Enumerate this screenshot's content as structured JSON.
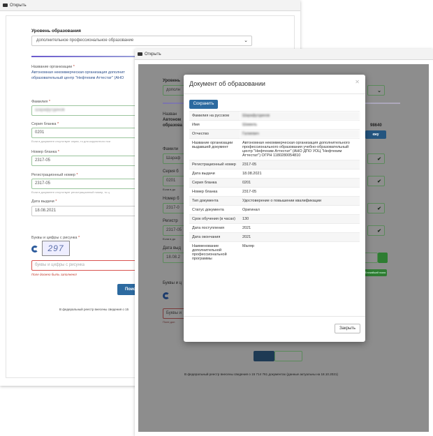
{
  "window_back": {
    "title": "Открыть",
    "education_level_label": "Уровень образования",
    "education_level_value": "дополнительное профессиональное образование",
    "org_label": "Название организации",
    "org_value_line1": "Автономная некоммерческая организация дополнит",
    "org_value_line2": "образовательный центр \"Нефтехим Аттестат\" (АНО",
    "surname_label": "Фамилия",
    "surname_value": "Шарафутдинов",
    "series_label": "Серия бланка",
    "series_value": "0201",
    "series_hint": "Если в документе отсутствует серия, то для корректного пои",
    "number_label": "Номер бланка",
    "number_value": "2317-05",
    "reg_label": "Регистрационный номер",
    "reg_value": "2317-05",
    "reg_hint": "Если в документе отсутствует регистрационный номер, то ц",
    "date_label": "Дата выдачи",
    "date_value": "18.08.2021",
    "captcha_label": "Буквы и цифры с рисунка",
    "captcha_text": "297",
    "captcha_placeholder": "буквы и цифры с рисунка",
    "captcha_error": "Поле должно быть заполнено!",
    "search_button": "Поиск",
    "footer": "В федеральный реестр внесены сведения о 15"
  },
  "window_front": {
    "title": "Открыть",
    "bg_labels": [
      "Уровень",
      "дополн",
      "Назван",
      "Автоном",
      "образова",
      "Фамили",
      "Шараф",
      "Серия б",
      "0201",
      "Если в до",
      "Номер б",
      "2317-0",
      "Регистр",
      "2317-05",
      "Если в до",
      "Дата выд",
      "18.08.2",
      "Буквы и ц",
      "Буквы и",
      "Поле доп"
    ],
    "bg_right_value": "98640",
    "bg_right_btn": "ежу",
    "bg_green_small": "Ближайший поиск",
    "footer": "В федеральный реестр внесены сведения о 15 714 761 документах (данные актуальны на 18.10.2021)"
  },
  "modal": {
    "title": "Документ об образовании",
    "save_button": "Сохранить",
    "close_button": "Закрыть",
    "rows": [
      {
        "k": "Фамилия на русском",
        "v": "Шарафутдинов",
        "blur": true
      },
      {
        "k": "Имя",
        "v": "Шамиль",
        "blur": true
      },
      {
        "k": "Отчество",
        "v": "Галиевич",
        "blur": true
      },
      {
        "k": "Название организации выдавшей документ",
        "v": "Автономная некоммерческая организация дополнительного профессионального образования учебно-образовательный центр \"Нефтехим Аттестат\" (АНО ДПО УОЦ \"Нефтехим Аттестат\") ОГРН 1180280054810",
        "blur": false
      },
      {
        "k": "Регистрационный номер",
        "v": "2317-05",
        "blur": false
      },
      {
        "k": "Дата выдачи",
        "v": "18.08.2021",
        "blur": false
      },
      {
        "k": "Серия бланка",
        "v": "0201",
        "blur": false
      },
      {
        "k": "Номер бланка",
        "v": "2317-05",
        "blur": false
      },
      {
        "k": "Тип документа",
        "v": "Удостоверение о повышении квалификации",
        "blur": false
      },
      {
        "k": "Статус документа",
        "v": "Оригинал",
        "blur": false
      },
      {
        "k": "Срок обучения (в часах)",
        "v": "130",
        "blur": false
      },
      {
        "k": "Дата поступления",
        "v": "2021",
        "blur": false
      },
      {
        "k": "Дата окончания",
        "v": "2021",
        "blur": false
      },
      {
        "k": "Наименование дополнительной профессиональной программы",
        "v": "Маляр",
        "blur": false
      }
    ]
  }
}
